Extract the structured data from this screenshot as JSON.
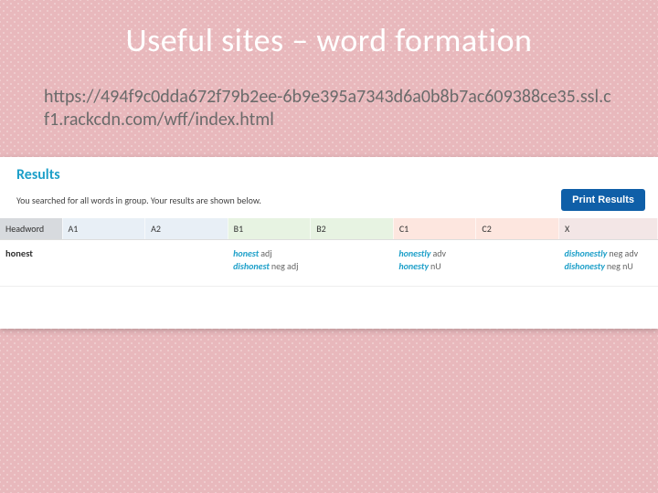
{
  "title": "Useful sites – word formation",
  "url": "https://494f9c0dda672f79b2ee-6b9e395a7343d6a0b8b7ac609388ce35.ssl.cf1.rackcdn.com/wff/index.html",
  "results": {
    "heading": "Results",
    "subtext": "You searched for all words in group. Your results are shown below.",
    "print_button": "Print Results",
    "columns": {
      "headword": "Headword",
      "a1": "A1",
      "a2": "A2",
      "b1": "B1",
      "b2": "B2",
      "c1": "C1",
      "c2": "C2",
      "x": "X"
    },
    "row": {
      "headword": "honest",
      "a1": "",
      "a2": "",
      "b1": [
        {
          "word": "honest",
          "pos": "adj"
        },
        {
          "word": "dishonest",
          "pos": "neg adj"
        }
      ],
      "b2": "",
      "c1": [
        {
          "word": "honestly",
          "pos": "adv"
        },
        {
          "word": "honesty",
          "pos": "nU"
        }
      ],
      "c2": "",
      "x": [
        {
          "word": "dishonestly",
          "pos": "neg adv"
        },
        {
          "word": "dishonesty",
          "pos": "neg nU"
        }
      ]
    }
  }
}
